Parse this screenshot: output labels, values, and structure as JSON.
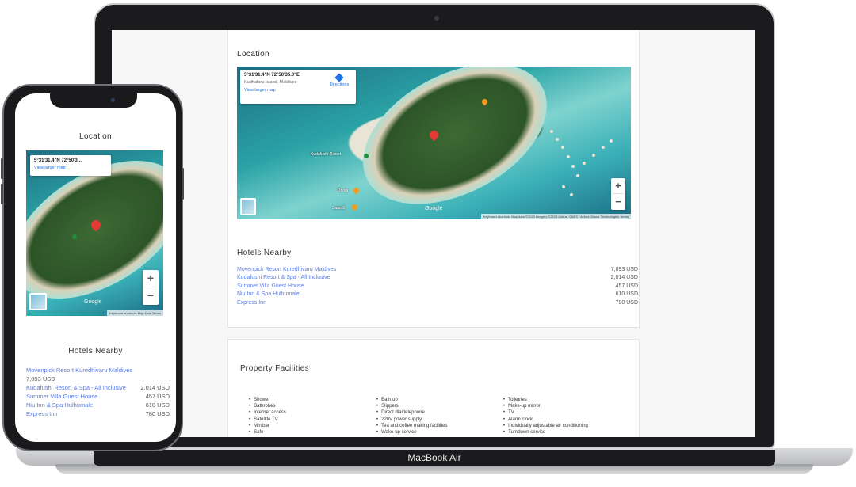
{
  "laptop": {
    "label": "MacBook Air",
    "location": {
      "title": "Location",
      "map": {
        "coords": "5°31'31.4\"N 72°50'35.0\"E",
        "address": "Kudhafaru Island, Maldives",
        "directions_label": "Directions",
        "larger_map_label": "View larger map",
        "zoom_in": "+",
        "zoom_out": "−",
        "google_logo": "Google",
        "footer": "Keyboard shortcuts   Map data ©2023 Imagery ©2023 Airbus, CNES / Airbus, Maxar Technologies   Terms",
        "place_label_1": "Kudafushi Resort",
        "place_label_2": "Dhoni",
        "place_label_3": "Saarab"
      }
    },
    "hotels_nearby": {
      "title": "Hotels Nearby",
      "items": [
        {
          "name": "Movenpick Resort Kuredhivaru Maldives",
          "price": "7,093 USD"
        },
        {
          "name": "Kudafushi Resort & Spa - All Inclusive",
          "price": "2,014 USD"
        },
        {
          "name": "Summer Villa Guest House",
          "price": "457 USD"
        },
        {
          "name": "Niu Inn & Spa Hulhumale",
          "price": "610 USD"
        },
        {
          "name": "Express Inn",
          "price": "780 USD"
        }
      ]
    },
    "facilities": {
      "title": "Property Facilities",
      "col1": [
        "Shower",
        "Bathrobes",
        "Internet access",
        "Satellite TV",
        "Minibar",
        "Safe"
      ],
      "col2": [
        "Bathtub",
        "Slippers",
        "Direct dial telephone",
        "220V power supply",
        "Tea and coffee making facilities",
        "Wake-up service"
      ],
      "col3": [
        "Toiletries",
        "Make-up mirror",
        "TV",
        "Alarm clock",
        "Individually adjustable air conditioning",
        "Turndown service"
      ]
    }
  },
  "phone": {
    "location": {
      "title": "Location",
      "map": {
        "coords": "5°31'31.4\"N 72°50'3...",
        "larger_map_label": "View larger map",
        "zoom_in": "+",
        "zoom_out": "−",
        "google_logo": "Google",
        "footer": "Keyboard shortcuts   Map Data   Terms"
      }
    },
    "hotels_nearby": {
      "title": "Hotels Nearby",
      "items": [
        {
          "name": "Movenpick Resort Kuredhivaru Maldives",
          "price": "7,093 USD"
        },
        {
          "name": "Kudafushi Resort & Spa - All Inclusive",
          "price": "2,014 USD"
        },
        {
          "name": "Summer Villa Guest House",
          "price": "457 USD"
        },
        {
          "name": "Niu Inn & Spa Hulhumale",
          "price": "610 USD"
        },
        {
          "name": "Express Inn",
          "price": "780 USD"
        }
      ]
    }
  },
  "colors": {
    "link": "#5b7be0",
    "pin": "#e53935",
    "device_frame": "#1b1b1d"
  }
}
